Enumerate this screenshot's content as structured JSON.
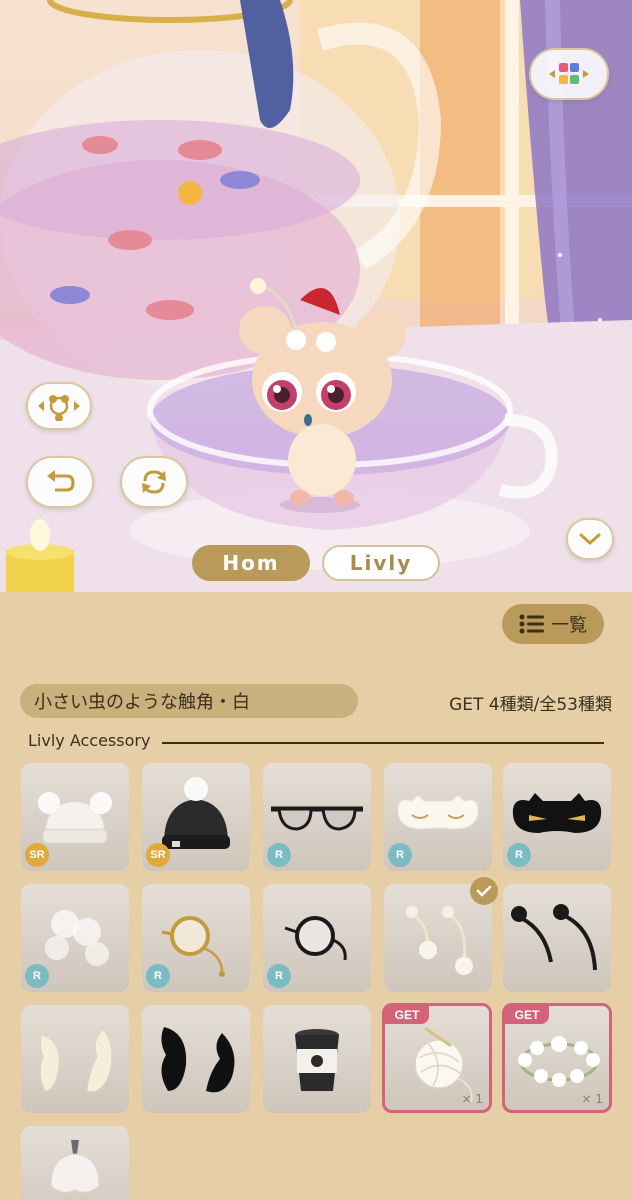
{
  "scene": {
    "mode_tabs": [
      {
        "label": "Hom",
        "active": true
      },
      {
        "label": "Livly",
        "active": false
      }
    ],
    "colors": {
      "accent": "#b99a5a",
      "tab_inactive_text": "#a88a50",
      "get_border": "#d4637a"
    }
  },
  "panel": {
    "list_button_label": "一覧",
    "selected_item_name": "小さい虫のような触角・白",
    "collection_count": "GET 4種類/全53種類",
    "section_label": "Livly Accessory",
    "items": [
      {
        "icon": "white-knit-hat",
        "rarity": "SR"
      },
      {
        "icon": "black-knit-hat",
        "rarity": "SR"
      },
      {
        "icon": "sunglasses",
        "rarity": "R"
      },
      {
        "icon": "white-sleep-mask",
        "rarity": "R"
      },
      {
        "icon": "black-eye-mask",
        "rarity": "R"
      },
      {
        "icon": "blurred-white-item",
        "rarity": "R"
      },
      {
        "icon": "gold-monocle",
        "rarity": "R"
      },
      {
        "icon": "black-monocle",
        "rarity": "R"
      },
      {
        "icon": "white-bug-antennae",
        "rarity": "",
        "selected": true
      },
      {
        "icon": "black-bug-antennae",
        "rarity": ""
      },
      {
        "icon": "white-claws",
        "rarity": ""
      },
      {
        "icon": "black-claws",
        "rarity": ""
      },
      {
        "icon": "coffee-cup",
        "rarity": ""
      },
      {
        "icon": "yarn-ball",
        "rarity": "",
        "get": true,
        "tag": "GET",
        "qty": "× 1"
      },
      {
        "icon": "flower-crown",
        "rarity": "",
        "get": true,
        "tag": "GET",
        "qty": "× 1"
      },
      {
        "icon": "white-bellflower",
        "rarity": ""
      }
    ]
  }
}
